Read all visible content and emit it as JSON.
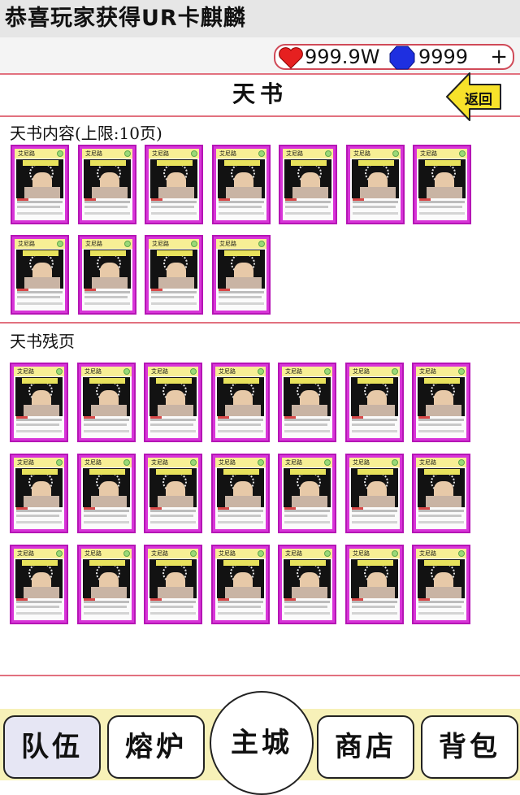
{
  "ticker": "恭喜玩家获得UR卡麒麟",
  "resources": {
    "hp": "999.9W",
    "gems": "9999",
    "add": "+"
  },
  "title": "天书",
  "back_label": "返回",
  "section1": {
    "label": "天书内容(上限:10页)"
  },
  "section2": {
    "label": "天书残页"
  },
  "card": {
    "name": "艾尼路",
    "count_contents": 11,
    "count_fragments": 21
  },
  "nav": {
    "team": "队伍",
    "furnace": "熔炉",
    "main": "主城",
    "shop": "商店",
    "bag": "背包"
  }
}
